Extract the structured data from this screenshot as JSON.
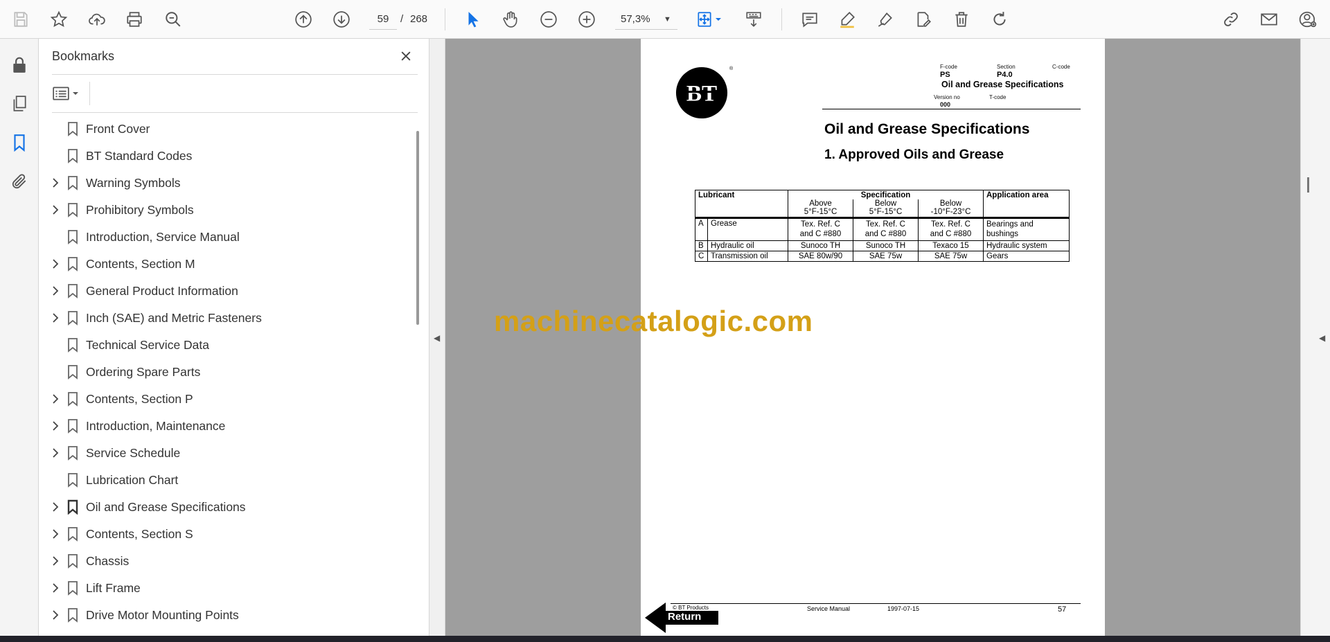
{
  "toolbar": {
    "current_page": "59",
    "page_separator": "/",
    "total_pages": "268",
    "zoom": "57,3%"
  },
  "panel": {
    "title": "Bookmarks"
  },
  "bookmarks": [
    {
      "label": "Front Cover",
      "expandable": false
    },
    {
      "label": "BT Standard Codes",
      "expandable": false
    },
    {
      "label": "Warning Symbols",
      "expandable": true
    },
    {
      "label": "Prohibitory Symbols",
      "expandable": true
    },
    {
      "label": "Introduction, Service Manual",
      "expandable": false
    },
    {
      "label": "Contents, Section M",
      "expandable": true
    },
    {
      "label": "General Product Information",
      "expandable": true
    },
    {
      "label": "Inch (SAE) and Metric Fasteners",
      "expandable": true
    },
    {
      "label": "Technical Service Data",
      "expandable": false
    },
    {
      "label": "Ordering Spare Parts",
      "expandable": false
    },
    {
      "label": "Contents, Section P",
      "expandable": true
    },
    {
      "label": "Introduction, Maintenance",
      "expandable": true
    },
    {
      "label": "Service Schedule",
      "expandable": true
    },
    {
      "label": "Lubrication Chart",
      "expandable": false
    },
    {
      "label": "Oil and Grease Specifications",
      "expandable": true,
      "active": true
    },
    {
      "label": "Contents, Section S",
      "expandable": true
    },
    {
      "label": "Chassis",
      "expandable": true
    },
    {
      "label": "Lift Frame",
      "expandable": true
    },
    {
      "label": "Drive Motor Mounting Points",
      "expandable": true
    }
  ],
  "document": {
    "logo_text": "BT",
    "registered_mark": "®",
    "header": {
      "fcode_label": "F-code",
      "section_label": "Section",
      "ccode_label": "C-code",
      "fcode_value": "PS",
      "section_value": "P4.0",
      "section_title": "Oil and Grease Specifications",
      "version_label": "Version no",
      "tcode_label": "T-code",
      "version_value": "000"
    },
    "title": "Oil and Grease Specifications",
    "heading": "1. Approved Oils and Grease",
    "table": {
      "col_lubricant": "Lubricant",
      "col_specification": "Specification",
      "col_application": "Application area",
      "sub_1_line1": "Above",
      "sub_1_line2": "5°F-15°C",
      "sub_2_line1": "Below",
      "sub_2_line2": "5°F-15°C",
      "sub_3_line1": "Below",
      "sub_3_line2": "-10°F-23°C",
      "rows": [
        {
          "code": "A",
          "lubricant": "Grease",
          "s1_line1": "Tex. Ref. C",
          "s1_line2": "and C #880",
          "s2_line1": "Tex. Ref. C",
          "s2_line2": "and C #880",
          "s3_line1": "Tex. Ref. C",
          "s3_line2": "and C #880",
          "app_line1": "Bearings and",
          "app_line2": "bushings"
        },
        {
          "code": "B",
          "lubricant": "Hydraulic oil",
          "s1_line1": "Sunoco TH",
          "s2_line1": "Sunoco TH",
          "s3_line1": "Texaco 15",
          "app_line1": "Hydraulic system"
        },
        {
          "code": "C",
          "lubricant": "Transmission oil",
          "s1_line1": "SAE 80w/90",
          "s2_line1": "SAE 75w",
          "s3_line1": "SAE 75w",
          "app_line1": "Gears"
        }
      ]
    },
    "footer": {
      "copyright": "© BT Products",
      "manual": "Service Manual",
      "date": "1997-07-15",
      "page_number": "57",
      "return_label": "Return"
    }
  },
  "watermark": "machinecatalogic.com",
  "colors": {
    "accent_blue": "#1473e6",
    "watermark": "#d4a017",
    "viewport_bg": "#9e9e9e"
  }
}
